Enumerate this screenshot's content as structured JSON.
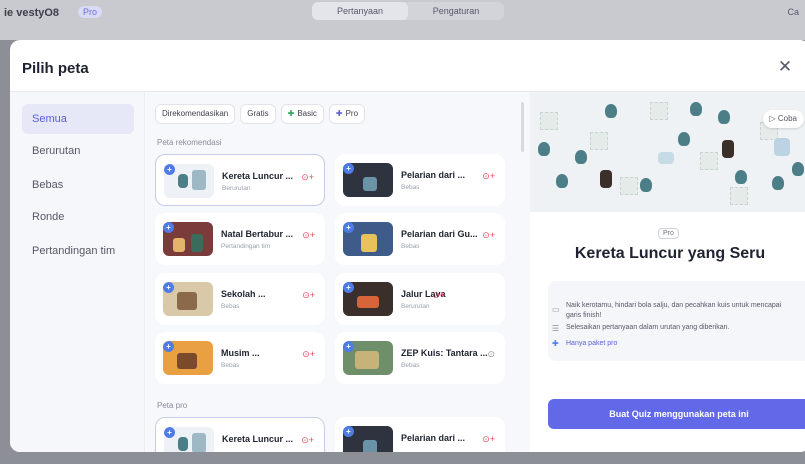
{
  "background": {
    "brand": "ie vestyO8",
    "badge": "Pro",
    "tabs": [
      "Pertanyaan",
      "Pengaturan"
    ],
    "right": "Ca"
  },
  "modal": {
    "title": "Pilih peta",
    "close_icon": "close-icon"
  },
  "sidebar": {
    "items": [
      {
        "label": "Semua",
        "active": true
      },
      {
        "label": "Berurutan",
        "active": false
      },
      {
        "label": "Bebas",
        "active": false
      },
      {
        "label": "Ronde",
        "active": false
      },
      {
        "label": "Pertandingan tim",
        "active": false
      }
    ]
  },
  "filters": [
    {
      "label": "Direkomendasikan",
      "icon": ""
    },
    {
      "label": "Gratis",
      "icon": ""
    },
    {
      "label": "Basic",
      "icon": "plus-icon"
    },
    {
      "label": "Pro",
      "icon": "plus-icon"
    }
  ],
  "sections": {
    "recommended": "Peta rekomendasi",
    "pro": "Peta pro"
  },
  "recommended_maps": [
    {
      "title": "Kereta Luncur ...",
      "sub": "Berurutan",
      "selected": true
    },
    {
      "title": "Pelarian dari ...",
      "sub": "Bebas",
      "selected": false
    },
    {
      "title": "Natal Bertabur ...",
      "sub": "Pertandingan tim",
      "selected": false
    },
    {
      "title": "Pelarian dari Gu...",
      "sub": "Bebas",
      "selected": false
    },
    {
      "title": "Sekolah ...",
      "sub": "Bebas",
      "selected": false
    },
    {
      "title": "Jalur Lava",
      "sub": "Berurutan",
      "selected": false
    },
    {
      "title": "Musim ...",
      "sub": "Bebas",
      "selected": false
    },
    {
      "title": "ZEP Kuis: Tantara ...",
      "sub": "Bebas",
      "selected": false
    }
  ],
  "pro_maps": [
    {
      "title": "Kereta Luncur ...",
      "sub": "",
      "selected": true
    },
    {
      "title": "Pelarian dari ...",
      "sub": "",
      "selected": false
    }
  ],
  "detail": {
    "coba_label": "Coba",
    "badge": "Pro",
    "title": "Kereta Luncur yang Seru",
    "info": [
      "Naik kerotamu, hindari bola salju, dan pecahkan kuis untuk mencapai garis finish!",
      "Selesaikan pertanyaan dalam urutan yang diberikan.",
      "Hanya paket pro"
    ],
    "create_button": "Buat Quiz menggunakan peta ini"
  },
  "colors": {
    "accent": "#6269e8",
    "sidebar_active_bg": "#e6e7f7",
    "sidebar_active_text": "#5a5fd9",
    "badge_red": "#e3485a",
    "basic_green": "#2da55a"
  }
}
